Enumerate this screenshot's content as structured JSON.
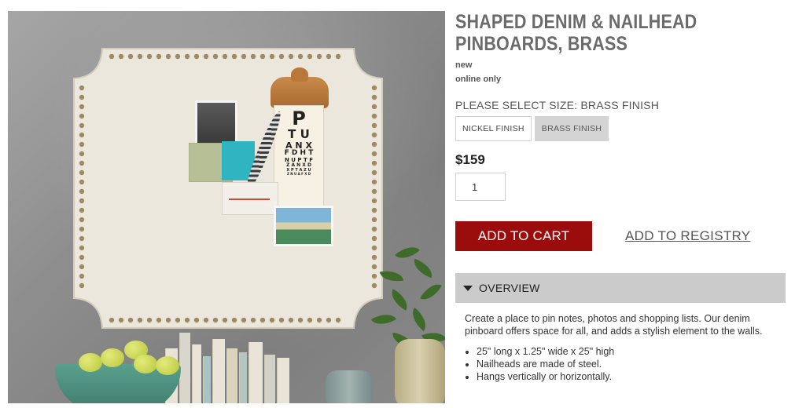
{
  "product": {
    "title_line1": "SHAPED DENIM & NAILHEAD",
    "title_line2": "PINBOARDS, BRASS",
    "badges": [
      "new",
      "online only"
    ],
    "size_label": "PLEASE SELECT SIZE: BRASS FINISH",
    "size_options": [
      {
        "label": "NICKEL FINISH",
        "selected": false
      },
      {
        "label": "BRASS FINISH",
        "selected": true
      }
    ],
    "price": "$159",
    "quantity": "1"
  },
  "actions": {
    "add_to_cart": "ADD TO CART",
    "add_to_registry": "ADD TO REGISTRY"
  },
  "overview": {
    "heading": "OVERVIEW",
    "description": "Create a place to pin notes, photos and shopping lists. Our denim pinboard offers space for all, and adds a stylish element to the walls.",
    "bullets": [
      "25\" long x 1.25\" wide x 25\" high",
      "Nailheads are made of steel.",
      "Hangs vertically or horizontally."
    ]
  },
  "eye_chart_rows": [
    "P",
    "T U",
    "A N X",
    "F D H T",
    "N U P T F",
    "Z A N X D",
    "X P T A Z U",
    "Z N U A F X D"
  ],
  "colors": {
    "cart_button": "#9b0d0d",
    "overview_bar": "#cbcbcb",
    "title": "#6b6b6b",
    "selected_option": "#d4d4d4"
  },
  "icons": {
    "overview_toggle": "caret-down-icon"
  }
}
